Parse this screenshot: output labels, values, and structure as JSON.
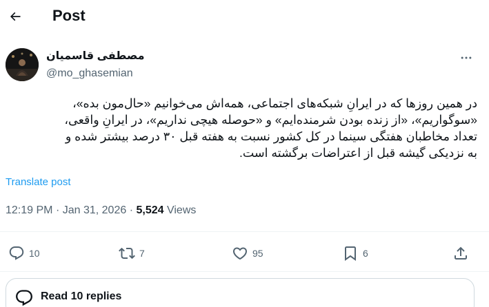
{
  "header": {
    "title": "Post"
  },
  "author": {
    "name": "مصطفی قاسمیان",
    "handle": "@mo_ghasemian"
  },
  "post": {
    "lines": [
      "در همین روزها که در ایرانِ شبکه‌های اجتماعی، همه‌اش می‌خوانیم «حال‌مون بده»،",
      "«سوگواریم»، «از زنده بودن شرمنده‌ایم» و «حوصله هیچی نداریم»، در ایرانِ واقعی،",
      "تعداد مخاطبان هفتگی سینما در کل کشور نسبت به هفته قبل ۳۰ درصد بیشتر شده و",
      "به نزدیکی گیشه قبل از اعتراضات برگشته است."
    ],
    "translate_label": "Translate post"
  },
  "meta": {
    "time": "12:19 PM",
    "separator": "·",
    "date": "Jan 31, 2026",
    "views_count": "5,524",
    "views_label": "Views"
  },
  "actions": {
    "replies": "10",
    "reposts": "7",
    "likes": "95",
    "bookmarks": "6"
  },
  "read_replies": {
    "label": "Read 10 replies"
  },
  "icons": {
    "back": "arrow-left-icon",
    "more": "more-horizontal-icon",
    "reply": "reply-icon",
    "repost": "repost-icon",
    "like": "heart-icon",
    "bookmark": "bookmark-icon",
    "share": "share-icon",
    "replies": "conversation-icon"
  },
  "colors": {
    "link": "#1d9bf0",
    "secondary_text": "#536471",
    "primary_text": "#0f1419",
    "border": "#cfd9de"
  }
}
